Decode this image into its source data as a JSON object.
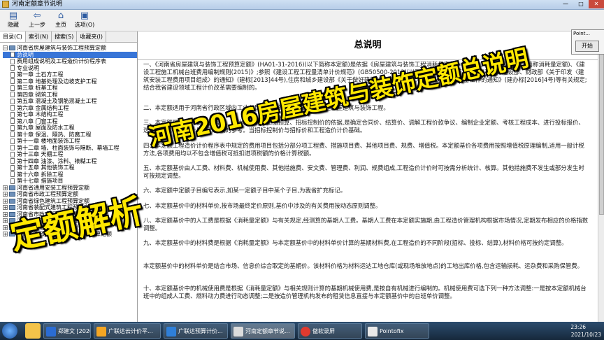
{
  "window": {
    "title": "河南定额章节说明"
  },
  "toolbar": {
    "buttons": [
      {
        "label": "隐藏",
        "icon": "hide-icon"
      },
      {
        "label": "上一步",
        "icon": "back-arrow-icon"
      },
      {
        "label": "主页",
        "icon": "home-icon"
      },
      {
        "label": "选项(O)",
        "icon": "options-icon"
      }
    ]
  },
  "left_tabs": [
    "目录(C)",
    "索引(N)",
    "搜索(S)",
    "收藏夹(I)"
  ],
  "tree": {
    "root": "河南省房屋建筑与装饰工程预算定额",
    "children": [
      "总说明",
      "费用组成说明及工程造价计价程序表",
      "专业说明",
      "第一章 土石方工程",
      "第二章 地基处理及边坡支护工程",
      "第三章 桩基工程",
      "第四章 砌筑工程",
      "第五章 混凝土及钢筋混凝土工程",
      "第六章 金属结构工程",
      "第七章 木结构工程",
      "第八章 门窗工程",
      "第九章 屋面及防水工程",
      "第十章 保温、隔热、防腐工程",
      "第十一章 楼地面装饰工程",
      "第十二章 墙、柱面装饰与隔断、幕墙工程",
      "第十三章 天棚工程",
      "第十四章 油漆、涂料、裱糊工程",
      "第十五章 其他装饰工程",
      "第十六章 拆除工程",
      "第十七章 措施项目"
    ],
    "others": [
      "河南省通用安装工程预算定额",
      "河南省市政工程预算定额",
      "河南省绿色建筑工程预算定额",
      "河南省装配式建筑工程预算定额",
      "河南省市政工程预算定额",
      "河南省城市地下综合管廊工程预算定额",
      "河南省城市轨道交通工程预算定额",
      "河南省市政公用设施养护维修预算定额"
    ]
  },
  "content": {
    "heading": "总说明",
    "paragraphs": [
      "一、《河南省房屋建筑与装饰工程预算定额》(HA01-31-2016)(以下简称本定额)是依据《房屋建筑与装饰工程消耗量定额》(TY01-31-2015)》(以下简称消耗量定额)、《建设工程施工机械台班费用编制规则(2015)》;参照《建设工程工程量清单计价规范》(GB50500-2013)(以下简称《计价规范》)、住房和城乡建设部、财政部《关于印发〈建筑安装工程费用项目组成〉的通知》(建标[2013]44号),住房和城乡建设部《关于做好建筑业营改增建设工程计价依据调整准备工作的通知》(建办标[2016]4号)等有关规定;结合我省建设领域工程计价改革需要编制的。",
      "二、本定额适用于河南省行政区域内工业与民用建筑的新建、扩建和改建房屋建筑与装饰工程。",
      "三、本定额是编审投资估算指标、设计概算、施工图预算、招标控制价的依据,是确定合同价、结算价、调解工程价款争议、编制企业定额、考核工程成本、进行投标报价、选择经济合理的设计与施工方案的参考。当招标控制价与招标价和工程造价计价基础。",
      "四、本定额工程造价计价程序表中规定的费用项目包括分部分项工程费、措施项目费、其他项目费、规费、增值税。本定额基价各项费用按照增值税原理编制,适用一般计税方法,各项费用均以不包含增值税可抵扣进项税额的价格计算税额。",
      "五、本定额基价由人工费、材料费、机械使用费、其他措施费、安文费、管理费、利润、规费组成,工程造价计价时可按需分析统计、核算。其他措施费不发生或部分发生时可按规定调整。",
      "六、本定额中定额子目编号表示,如某一定额子目中某个子目,为我省扩充标记。",
      "七、本定额基价中的材料单价,按市场最终定价原则,基价中涉及的有关费用按动态原则调整。",
      "八、本定额基价中的人工费是根据《消耗量定额》与有关规定,经测算的基期人工费。基期人工费在本定额实施期,由工程造价管理机构根据市场情况,定期发布相应的价格指数调整。",
      "九、本定额基价中的材料费是根据《消耗量定额》与本定额基价中的材料单价计算的基期材料费,在工程造价的不同阶段(招标、投标、结算),材料价格可按约定调整。",
      "本定额基价中的材料单价是结合市场、信息价综合取定的基期价。该材料价格为材料运达工地仓库(或现场堆放地点)的工地出库价格,包含运输损耗、运杂费和采购保管费。",
      "十、本定额基价中的机械使用费是根据《消耗量定额》与相关规则计算的基期机械使用费,是按自有机械进行编制的。机械使用费可选下列一种方法调整:一是按本定额机械台班中的组成人工费、燃料动力费进行动态调整;二是按造价管理机构发布的租赁信息直接与本定额基价中的台班单价调整。"
    ]
  },
  "overlay": {
    "line1": "河南2016房屋建筑与装饰定额总说明",
    "line2": "定额解析"
  },
  "pointofix": {
    "title": "Point...",
    "start": "开始"
  },
  "taskbar": {
    "tasks": [
      "郑建文 [2020...",
      "广联达云计价平...",
      "广联达预算计价...",
      "河南定额章节说...",
      "傲软录屏",
      "Pointofix"
    ],
    "time": "23:26",
    "date": "2021/10/23"
  }
}
